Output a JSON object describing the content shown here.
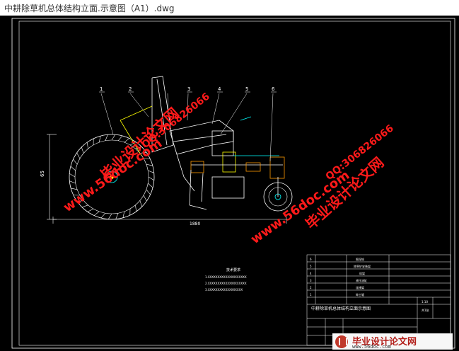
{
  "window": {
    "title": "中耕除草机总体结构立面.示意图（A1）.dwg"
  },
  "drawing": {
    "part_labels": [
      "1",
      "2",
      "3",
      "4",
      "5",
      "6"
    ],
    "dimension_height": "65",
    "dimension_length": "1880",
    "tech_requirements": {
      "heading": "技术要求",
      "lines": [
        "1.XXXXXXXXXXXXXXXXXXXX",
        "2.XXXXXXXXXXXXXXXXXXXX",
        "3.XXXXXXXXXXXXXXXXXX"
      ]
    },
    "title_block": {
      "parts_rows": [
        {
          "no": "6",
          "name": "限深轮"
        },
        {
          "no": "5",
          "name": "除草铲安装架"
        },
        {
          "no": "4",
          "name": "机架"
        },
        {
          "no": "3",
          "name": "液压油缸"
        },
        {
          "no": "2",
          "name": "连接架"
        },
        {
          "no": "1",
          "name": "碎土辊"
        }
      ],
      "drawing_name": "中耕除草机总体结构立面示意图",
      "scale": "1:10",
      "sheet": "共1张"
    }
  },
  "watermarks": [
    {
      "text": "毕业设计论文网"
    },
    {
      "text": "www.56doc.com"
    },
    {
      "text": "QQ:306826066"
    }
  ],
  "footer": {
    "brand": "毕业设计论文网",
    "url": "www.56doc.com"
  },
  "colors": {
    "canvas": "#000000",
    "line": "#ffffff",
    "cyan": "#00ffff",
    "yellow": "#ffff00",
    "magenta": "#ff00ff",
    "watermark": "#ff0000"
  }
}
